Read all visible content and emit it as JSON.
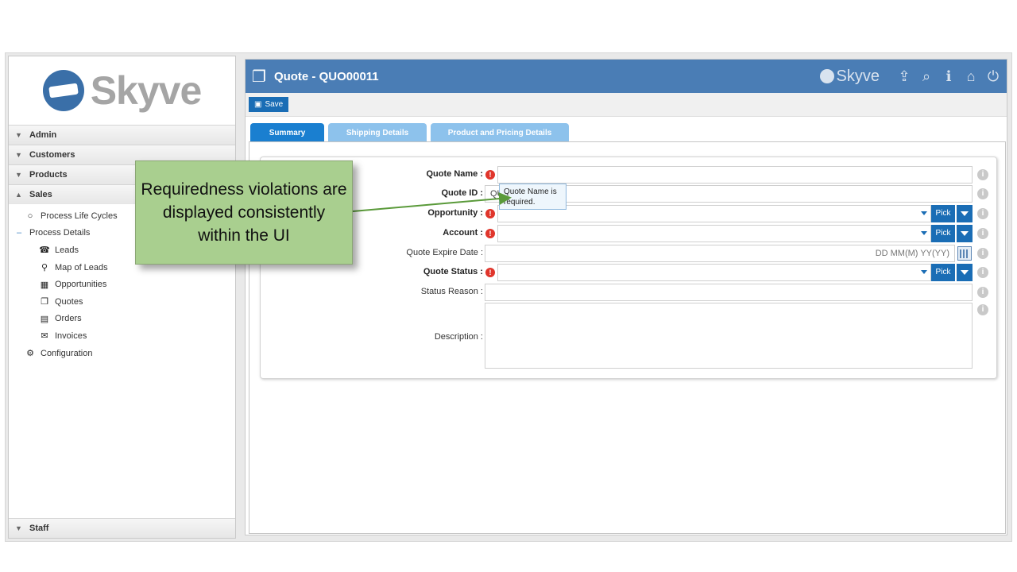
{
  "sidebar": {
    "logo_text": "Skyve",
    "sections": [
      {
        "label": "Admin",
        "chevron": "double-chevron-down-icon"
      },
      {
        "label": "Customers",
        "chevron": "double-chevron-down-icon"
      },
      {
        "label": "Products",
        "chevron": "double-chevron-down-icon"
      },
      {
        "label": "Sales",
        "chevron": "double-chevron-up-icon"
      }
    ],
    "tree": [
      {
        "label": "Process Life Cycles",
        "icon": "circle-icon"
      },
      {
        "label": "Process Details",
        "icon": "tree-branch-icon"
      },
      {
        "label": "Leads",
        "icon": "phone-icon"
      },
      {
        "label": "Map of Leads",
        "icon": "map-pin-icon"
      },
      {
        "label": "Opportunities",
        "icon": "calculator-icon"
      },
      {
        "label": "Quotes",
        "icon": "copy-icon"
      },
      {
        "label": "Orders",
        "icon": "file-icon"
      },
      {
        "label": "Invoices",
        "icon": "envelope-icon"
      },
      {
        "label": "Configuration",
        "icon": "gears-icon"
      }
    ],
    "footer_section": "Staff"
  },
  "header": {
    "title": "Quote - QUO00011",
    "brand": "Skyve",
    "icons": [
      "share-icon",
      "search-icon",
      "info-icon",
      "home-icon",
      "power-icon"
    ]
  },
  "toolbar": {
    "save_label": "Save"
  },
  "tabs": [
    {
      "label": "Summary",
      "active": true
    },
    {
      "label": "Shipping Details",
      "active": false
    },
    {
      "label": "Product and Pricing Details",
      "active": false
    }
  ],
  "form": {
    "quote_name_label": "Quote Name :",
    "quote_name_value": "",
    "quote_id_label": "Quote ID :",
    "quote_id_value": "QU",
    "opportunity_label": "Opportunity :",
    "account_label": "Account :",
    "quote_expire_label": "Quote Expire Date :",
    "quote_expire_placeholder": "DD MM(M) YY(YY)",
    "quote_status_label": "Quote Status :",
    "status_reason_label": "Status Reason :",
    "description_label": "Description :",
    "pick_label": "Pick"
  },
  "tooltip_text": "Quote Name is required.",
  "callout_text": "Requiredness violations are displayed consistently within the UI",
  "colors": {
    "header": "#4a7db5",
    "button": "#1a6db5",
    "callout": "#a9cf8f",
    "error": "#e0352b"
  }
}
